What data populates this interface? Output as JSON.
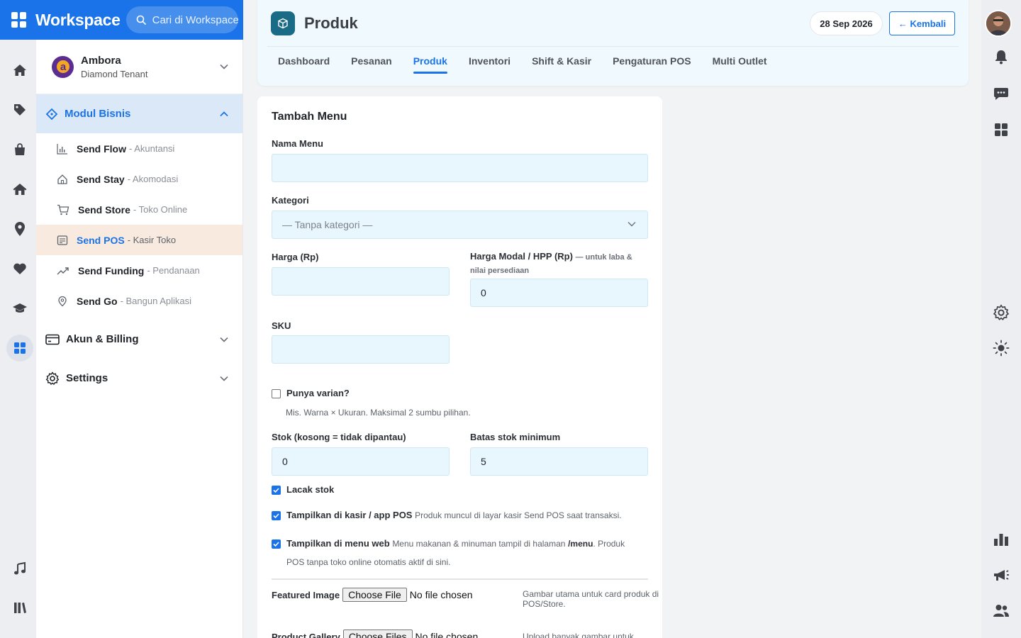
{
  "brand": {
    "title": "Workspace",
    "search_placeholder": "Cari di Workspace"
  },
  "tenant": {
    "name": "Ambora",
    "tier": "Diamond Tenant"
  },
  "sidebar": {
    "modul_label": "Modul Bisnis",
    "items": [
      {
        "name": "Send Flow",
        "desc": "- Akuntansi"
      },
      {
        "name": "Send Stay",
        "desc": "- Akomodasi"
      },
      {
        "name": "Send Store",
        "desc": "- Toko Online"
      },
      {
        "name": "Send POS",
        "desc": "- Kasir Toko"
      },
      {
        "name": "Send Funding",
        "desc": "- Pendanaan"
      },
      {
        "name": "Send Go",
        "desc": "- Bangun Aplikasi"
      }
    ],
    "akun_label": "Akun & Billing",
    "settings_label": "Settings"
  },
  "header": {
    "title": "Produk",
    "date": "28 Sep 2026",
    "back_label": "← Kembali",
    "tabs": [
      "Dashboard",
      "Pesanan",
      "Produk",
      "Inventori",
      "Shift & Kasir",
      "Pengaturan POS",
      "Multi Outlet"
    ],
    "active_tab": "Produk"
  },
  "form": {
    "title": "Tambah Menu",
    "nama_label": "Nama Menu",
    "nama_value": "",
    "kategori_label": "Kategori",
    "kategori_value": "— Tanpa kategori —",
    "harga_label": "Harga (Rp)",
    "harga_value": "",
    "modal_label": "Harga Modal / HPP (Rp)",
    "modal_hint": "— untuk laba & nilai persediaan",
    "modal_value": "0",
    "sku_label": "SKU",
    "sku_value": "",
    "varian_label": "Punya varian?",
    "varian_checked": false,
    "varian_note": "Mis. Warna × Ukuran. Maksimal 2 sumbu pilihan.",
    "stok_label": "Stok (kosong = tidak dipantau)",
    "stok_value": "0",
    "batas_label": "Batas stok minimum",
    "batas_value": "5",
    "lacak_label": "Lacak stok",
    "lacak_checked": true,
    "kasir_label": "Tampilkan di kasir / app POS",
    "kasir_desc": "Produk muncul di layar kasir Send POS saat transaksi.",
    "kasir_checked": true,
    "web_label": "Tampilkan di menu web",
    "web_desc_a": "Menu makanan & minuman tampil di halaman",
    "web_desc_path": "/menu",
    "web_desc_b": ". Produk POS tanpa toko online otomatis aktif di sini.",
    "web_checked": true,
    "featured_label": "Featured Image",
    "featured_btn": "Choose File",
    "featured_status": "No file chosen",
    "featured_note": "Gambar utama untuk card produk di POS/Store.",
    "gallery_label": "Product Gallery",
    "gallery_btn": "Choose Files",
    "gallery_status": "No file chosen",
    "gallery_note": "Upload banyak gambar untuk"
  },
  "colors": {
    "accent": "#1a73e8",
    "input_bg": "#e8f7fd",
    "active_item_bg": "#f8eadf"
  }
}
